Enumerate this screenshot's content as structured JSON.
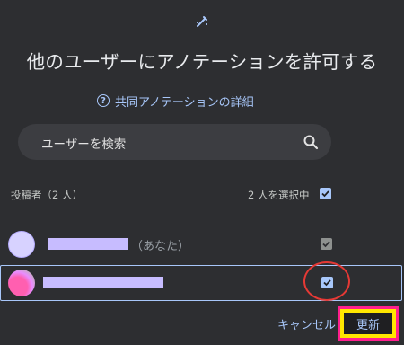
{
  "dialog": {
    "title": "他のユーザーにアノテーションを許可する",
    "help_link": "共同アノテーションの詳細",
    "search_placeholder": "ユーザーを検索",
    "contributors_label": "投稿者（2 人）",
    "selected_count": "2 人を選択中",
    "users": [
      {
        "name": "",
        "suffix": "（あなた）",
        "checked": true,
        "disabled": true
      },
      {
        "name": "",
        "suffix": "",
        "checked": true,
        "disabled": false
      }
    ],
    "buttons": {
      "cancel": "キャンセル",
      "update": "更新"
    },
    "colors": {
      "accent": "#a8c7fa",
      "background": "#2d2e31",
      "highlight_border": "#ff1f8e",
      "highlight_fill": "#ffe600",
      "annotation_circle": "#e53935"
    },
    "icons": [
      "annotation-pen-icon",
      "help-icon",
      "search-icon",
      "checkmark-icon"
    ]
  }
}
